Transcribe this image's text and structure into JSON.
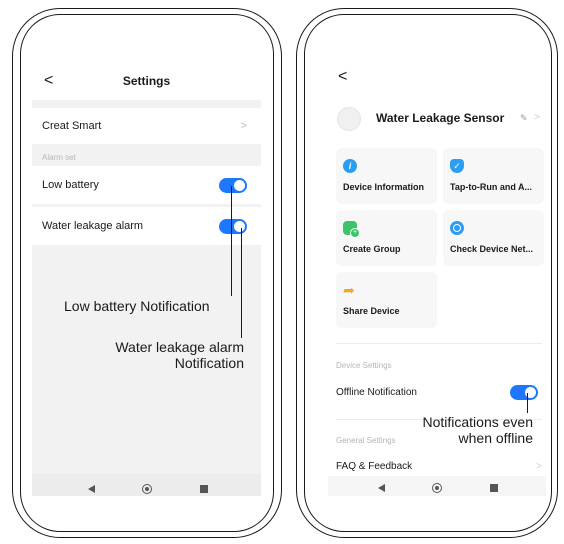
{
  "left_screen": {
    "header": {
      "title": "Settings",
      "back": "<"
    },
    "rows": [
      {
        "label": "Creat Smart",
        "chevron": ">"
      }
    ],
    "section_label": "Alarm set",
    "toggles": [
      {
        "label": "Low battery",
        "on": true
      },
      {
        "label": "Water leakage alarm",
        "on": true
      }
    ]
  },
  "right_screen": {
    "back": "<",
    "device": {
      "name": "Water Leakage Sensor",
      "edit_icon": "pencil-icon",
      "chevron": ">"
    },
    "tiles": [
      {
        "label": "Device Information",
        "icon": "info-icon",
        "color": "#2a9df4"
      },
      {
        "label": "Tap-to-Run and A...",
        "icon": "check-shield-icon",
        "color": "#2a9df4"
      },
      {
        "label": "Create Group",
        "icon": "group-add-icon",
        "color": "#3cc36b"
      },
      {
        "label": "Check Device Net...",
        "icon": "network-icon",
        "color": "#2a9df4"
      },
      {
        "label": "Share Device",
        "icon": "share-arrow-icon",
        "color": "#f5a623"
      }
    ],
    "device_settings_label": "Device Settings",
    "offline_notification": {
      "label": "Offline Notification",
      "on": true
    },
    "general_settings_label": "General Settings",
    "faq": {
      "label": "FAQ & Feedback",
      "chevron": ">"
    }
  },
  "annotations": {
    "low_battery": "Low battery Notification",
    "water_leakage_line1": "Water leakage alarm",
    "water_leakage_line2": "Notification",
    "offline_line1": "Notifications even",
    "offline_line2": "when offline"
  },
  "colors": {
    "toggle_on": "#1e78ff",
    "screen_bg": "#f2f2f2"
  }
}
